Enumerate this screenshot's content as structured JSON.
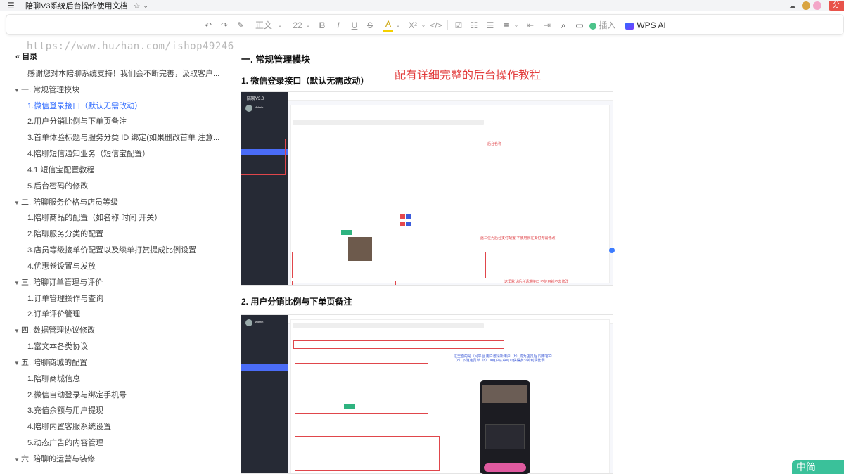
{
  "titlebar": {
    "doc_title": "陪聊V3系统后台操作使用文档",
    "star": "☆",
    "chevron": "⌄",
    "share_label": "分"
  },
  "toolbar": {
    "style_label": "正文",
    "font_size": "22",
    "insert_label": "插入",
    "wps_ai_label": "WPS AI"
  },
  "watermark": "https://www.huzhan.com/ishop49246",
  "toc": {
    "header": "目录",
    "items": [
      {
        "level": 2,
        "label": "感谢您对本陪聊系统支持！我们会不断完善，汲取客户..."
      },
      {
        "level": 1,
        "label": "一. 常规管理模块"
      },
      {
        "level": 2,
        "label": "1.微信登录接口（默认无需改动）",
        "active": true
      },
      {
        "level": 2,
        "label": "2.用户分销比例与下单页备注"
      },
      {
        "level": 2,
        "label": "3.首单体验标题与服务分类 ID 绑定(如果删改首单 注意..."
      },
      {
        "level": 2,
        "label": "4.陪聊短信通知业务（短信宝配置）"
      },
      {
        "level": 2,
        "label": "4.1 短信宝配置教程"
      },
      {
        "level": 2,
        "label": "5.后台密码的修改"
      },
      {
        "level": 1,
        "label": "二. 陪聊服务价格与店员等级"
      },
      {
        "level": 2,
        "label": "1.陪聊商品的配置（如名称 时间 开关）"
      },
      {
        "level": 2,
        "label": "2.陪聊服务分类的配置"
      },
      {
        "level": 2,
        "label": "3.店员等级接单价配置以及续单打赏提成比例设置"
      },
      {
        "level": 2,
        "label": "4.优惠卷设置与发放"
      },
      {
        "level": 1,
        "label": "三. 陪聊订单管理与评价"
      },
      {
        "level": 2,
        "label": "1.订单管理操作与查询"
      },
      {
        "level": 2,
        "label": "2.订单评价管理"
      },
      {
        "level": 1,
        "label": "四. 数据管理协议修改"
      },
      {
        "level": 2,
        "label": "1.富文本各类协议"
      },
      {
        "level": 1,
        "label": "五. 陪聊商城的配置"
      },
      {
        "level": 2,
        "label": "1.陪聊商城信息"
      },
      {
        "level": 2,
        "label": "2.微信自动登录与绑定手机号"
      },
      {
        "level": 2,
        "label": "3.充值余额与用户提现"
      },
      {
        "level": 2,
        "label": "4.陪聊内置客服系统设置"
      },
      {
        "level": 2,
        "label": "5.动态广告的内容管理"
      },
      {
        "level": 1,
        "label": "六. 陪聊的运营与装修"
      }
    ]
  },
  "content": {
    "h1": "一. 常规管理模块",
    "banner": "配有详细完整的后台操作教程",
    "section1_title": "1. 微信登录接口（默认无需改动）",
    "section2_title": "2. 用户分销比例与下单页备注",
    "shot1": {
      "app_name": "陪聊V3.0",
      "admin": "Admin",
      "note_name": "后台名称",
      "note_pay": "此三位为后台支付配置 不使用就在支付无需修改",
      "note_url": "这里默认后台请求接口 不使用就不去修改"
    },
    "shot2": {
      "admin": "Admin",
      "note_share": "这里面的是（a)平台 用户邀请新用户（b）成为店员后 同推客户（c）下消店员单（b） a用户从中可以获得多少的利润比例"
    }
  },
  "float_badge": "中简"
}
